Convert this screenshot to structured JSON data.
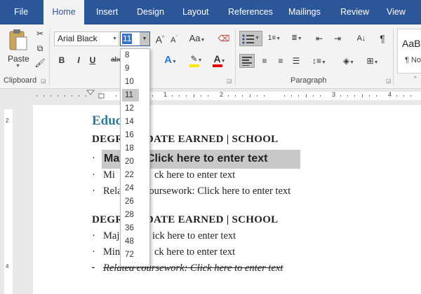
{
  "tabs": [
    "File",
    "Home",
    "Insert",
    "Design",
    "Layout",
    "References",
    "Mailings",
    "Review",
    "View"
  ],
  "ribbon": {
    "clipboard_label": "Clipboard",
    "paste_label": "Paste",
    "font_name": "Arial Black",
    "font_size": "11",
    "paragraph_label": "Paragraph",
    "styles_preview": "AaBb",
    "styles_name": "¶ No",
    "bold": "B",
    "italic": "I",
    "underline": "U",
    "strike": "abc",
    "grow": "A",
    "shrink": "A",
    "case": "Aa",
    "font_color_glyph": "A",
    "text_effect_glyph": "A",
    "pilcrow": "¶"
  },
  "colors": {
    "ribbon_blue": "#2b579a",
    "heading_teal": "#2d7c93",
    "highlight_yellow": "#ffe600",
    "font_red": "#e00000"
  },
  "font_sizes": [
    "8",
    "9",
    "10",
    "11",
    "12",
    "14",
    "16",
    "18",
    "20",
    "22",
    "24",
    "26",
    "28",
    "36",
    "48",
    "72"
  ],
  "selected_font_size": "11",
  "document": {
    "heading": "Education",
    "degree1": "DEGREE | DATE EARNED | SCHOOL",
    "degree2": "DEGREE | DATE EARNED | SCHOOL",
    "bullet": "·",
    "b1_major_prefix": "Ma",
    "b1_major_text": "Click here to enter text",
    "b1_minor_prefix": "Mi",
    "b1_minor_text": "ck here to enter text",
    "b1_related_prefix": "Rela",
    "b1_related_text": "coursework: Click here to enter text",
    "b2_major_prefix": "Maj",
    "b2_major_text": "ick here to enter text",
    "b2_minor_prefix": "Min",
    "b2_minor_text": "ck here to enter text",
    "b2_related_text": "Related coursework: Click here to enter text"
  },
  "ruler_numbers": [
    "1",
    "2",
    "3",
    "4"
  ]
}
